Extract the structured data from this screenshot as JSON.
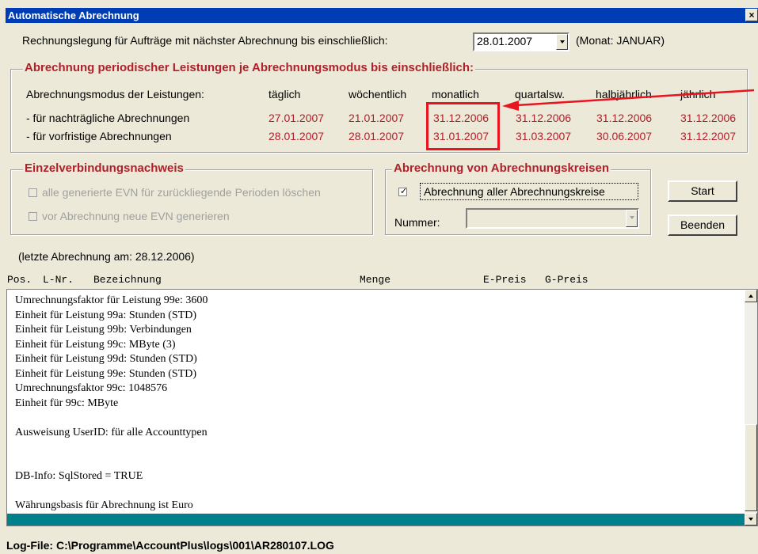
{
  "window": {
    "title": "Automatische Abrechnung",
    "close_label": "×"
  },
  "billing_date": {
    "label": "Rechnungslegung für Aufträge mit nächster Abrechnung bis einschließlich:",
    "value": "28.01.2007",
    "month_text": "(Monat: JANUAR)"
  },
  "periodic": {
    "title": "Abrechnung periodischer Leistungen je Abrechnungsmodus bis einschließlich:",
    "header_label": "Abrechnungsmodus der Leistungen:",
    "columns": [
      "täglich",
      "wöchentlich",
      "monatlich",
      "quartalsw.",
      "halbjährlich",
      "jährlich"
    ],
    "rows": [
      {
        "label": "- für nachträgliche Abrechnungen",
        "values": [
          "27.01.2007",
          "21.01.2007",
          "31.12.2006",
          "31.12.2006",
          "31.12.2006",
          "31.12.2006"
        ]
      },
      {
        "label": "- für vorfristige Abrechnungen",
        "values": [
          "28.01.2007",
          "28.01.2007",
          "31.01.2007",
          "31.03.2007",
          "30.06.2007",
          "31.12.2007"
        ]
      }
    ]
  },
  "evn": {
    "title": "Einzelverbindungsnachweis",
    "options": [
      "alle generierte EVN für zurückliegende Perioden löschen",
      "vor Abrechnung neue EVN generieren"
    ]
  },
  "kreise": {
    "title": "Abrechnung von Abrechnungskreisen",
    "all_label": "Abrechnung aller Abrechnungskreise",
    "all_checked": true,
    "number_label": "Nummer:",
    "number_value": ""
  },
  "buttons": {
    "start": "Start",
    "exit": "Beenden"
  },
  "last_run": "(letzte Abrechnung am: 28.12.2006)",
  "list": {
    "headers": {
      "pos": "Pos.",
      "lnr": "L-Nr.",
      "bez": "Bezeichnung",
      "menge": "Menge",
      "epreis": "E-Preis",
      "gpreis": "G-Preis"
    },
    "lines": [
      "Umrechnungsfaktor für Leistung 99e: 3600",
      "Einheit für Leistung 99a: Stunden (STD)",
      "Einheit für Leistung 99b: Verbindungen",
      "Einheit für Leistung 99c: MByte (3)",
      "Einheit für Leistung 99d: Stunden (STD)",
      "Einheit für Leistung 99e: Stunden (STD)",
      "Umrechnungsfaktor 99c: 1048576",
      "Einheit für 99c: MByte",
      "",
      "Ausweisung UserID: für alle Accounttypen",
      "",
      "",
      "DB-Info: SqlStored = TRUE",
      "",
      "Währungsbasis für Abrechnung ist Euro"
    ]
  },
  "status": {
    "logfile": "Log-File: C:\\Programme\\AccountPlus\\logs\\001\\AR280107.LOG"
  },
  "colors": {
    "title_bar": "#003cb4",
    "red_text": "#b0202a",
    "highlight": "#e8141f",
    "selected_row": "#00808a"
  }
}
